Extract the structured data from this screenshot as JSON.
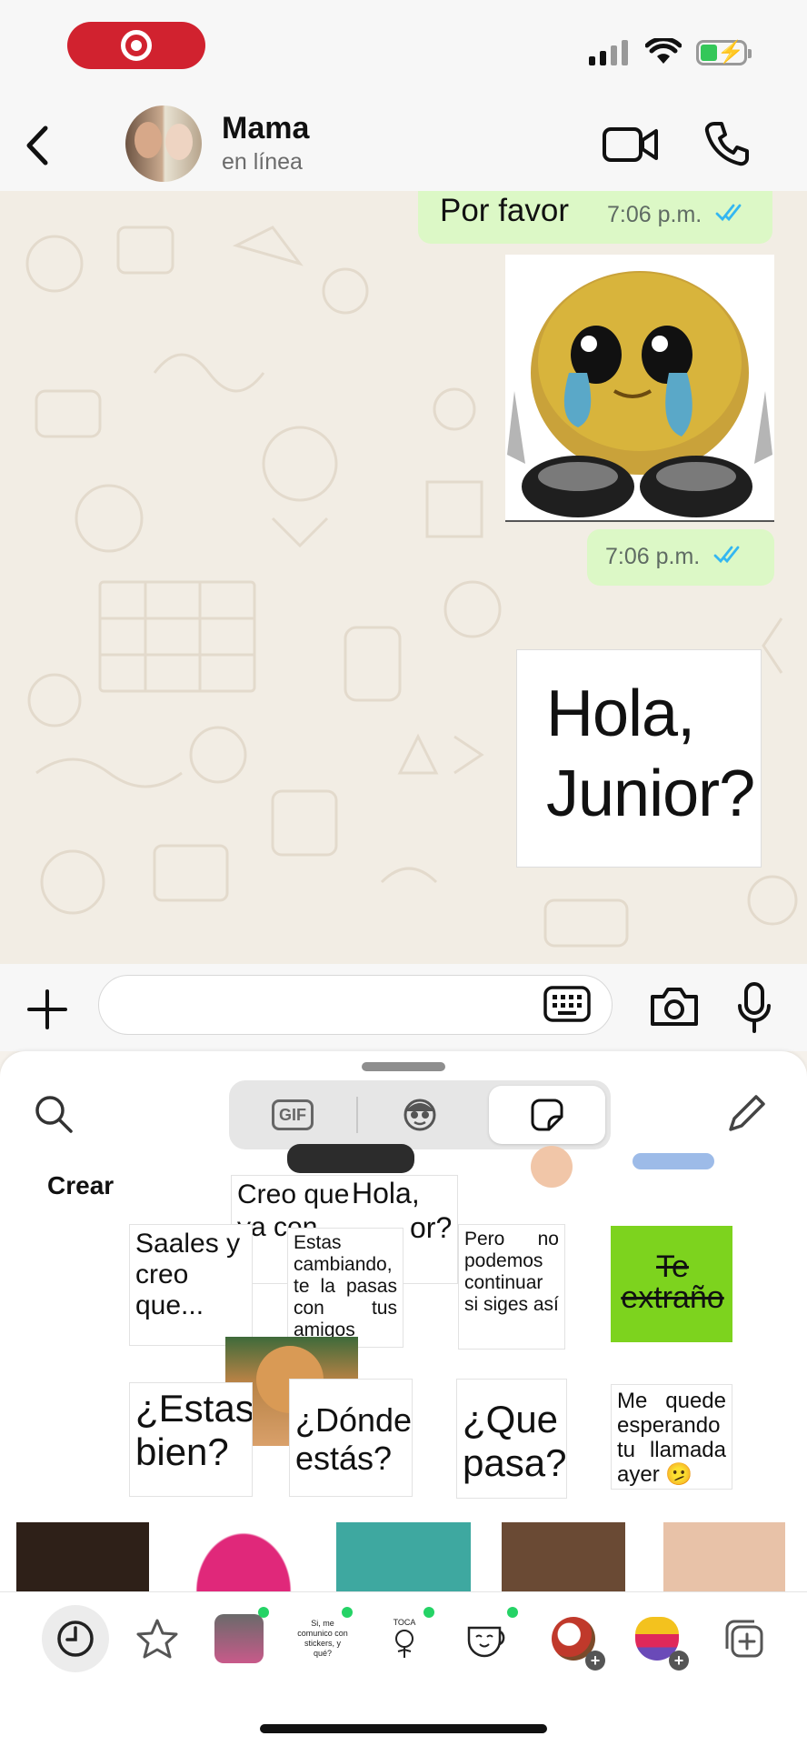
{
  "status_bar": {
    "recording": true,
    "icons": [
      "record-icon",
      "signal-icon",
      "wifi-icon",
      "battery-charging-icon"
    ]
  },
  "header": {
    "contact_name": "Mama",
    "contact_status": "en línea"
  },
  "messages": {
    "text_message": "Por favor",
    "text_time": "7:06 p.m.",
    "sticker_time": "7:06 p.m.",
    "hola_sticker_text": "Hola, Junior?"
  },
  "composer": {
    "placeholder": ""
  },
  "panel": {
    "segments": [
      {
        "label": "GIF",
        "icon": "gif-icon"
      },
      {
        "label": "",
        "icon": "avatar-icon"
      },
      {
        "label": "",
        "icon": "sticker-icon",
        "active": true
      }
    ],
    "crear_label": "Crear",
    "stickers": {
      "creo_que": "Creo que",
      "ya_con": "ya con",
      "hola_top": "Hola,",
      "or_partial": "or?",
      "saales": "Saales y creo que...",
      "estas_cambiando": "Estas cambiando, te la pasas con tus amigos",
      "pero_no": "Pero no podemos continuar si siges así",
      "te_extrano": "Te extraño",
      "estas_bien": "¿Estas bien?",
      "donde_estas": "¿Dónde estás?",
      "que_pasa": "¿Que pasa?",
      "me_quede": "Me quede esperando tu llamada ayer 🫤"
    },
    "tabs": {
      "comunico_label": "Si, me comunico con stickers, y qué?",
      "toca_label": "TOCA"
    },
    "accent": "#25d366"
  },
  "colors": {
    "outgoing_bubble": "#dcf8c6",
    "read_ticks": "#34b7f1",
    "record_pill": "#d1222f"
  }
}
